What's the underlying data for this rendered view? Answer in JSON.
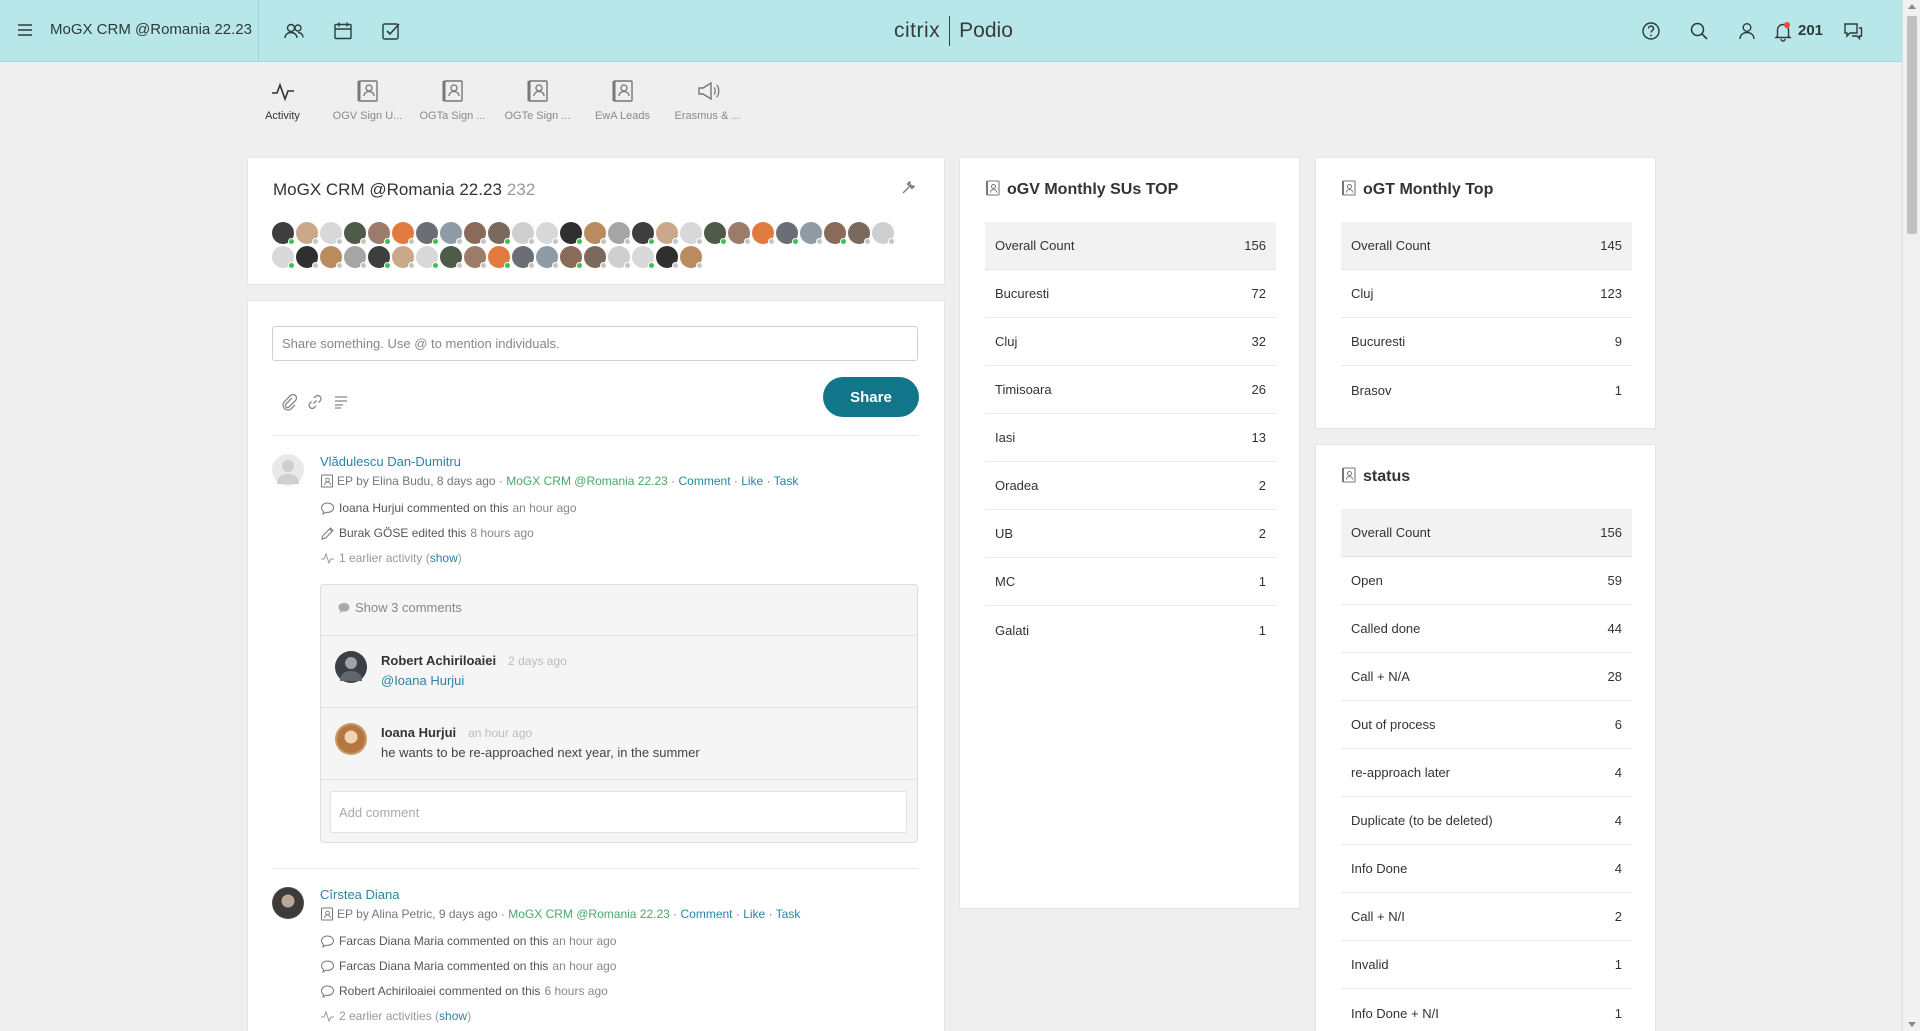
{
  "topbar": {
    "workspace_title": "MoGX CRM @Romania 22.23",
    "brand_left": "citrix",
    "brand_right": "Podio",
    "notification_count": "201"
  },
  "app_tabs": [
    {
      "label": "Activity",
      "icon": "activity-icon",
      "active": true
    },
    {
      "label": "OGV Sign U...",
      "icon": "app-icon",
      "active": false
    },
    {
      "label": "OGTa Sign ...",
      "icon": "app-icon",
      "active": false
    },
    {
      "label": "OGTe Sign ...",
      "icon": "app-icon",
      "active": false
    },
    {
      "label": "EwA Leads",
      "icon": "app-icon",
      "active": false
    },
    {
      "label": "Erasmus & ...",
      "icon": "megaphone-icon",
      "active": false
    }
  ],
  "workspace": {
    "name": "MoGX CRM @Romania 22.23",
    "member_count": "232"
  },
  "share": {
    "placeholder": "Share something. Use @ to mention individuals.",
    "button": "Share"
  },
  "posts": [
    {
      "title": "Vlădulescu Dan-Dumitru",
      "app": "EP",
      "by": "by",
      "author": "Elina Budu, 8 days ago",
      "workspace": "MoGX CRM @Romania 22.23",
      "actions": [
        "Comment",
        "Like",
        "Task"
      ],
      "activities": [
        {
          "text": "Ioana Hurjui commented on this",
          "ago": "an hour ago",
          "icon": "comment-icon"
        },
        {
          "text": "Burak GÖSE edited this",
          "ago": "8 hours ago",
          "icon": "pencil-icon"
        }
      ],
      "earlier": "1 earlier activity",
      "earlier_link": "show",
      "show_comments": "Show 3 comments",
      "comments": [
        {
          "name": "Robert Achiriloaiei",
          "time": "2 days ago",
          "text": "@Ioana Hurjui",
          "mention": true
        },
        {
          "name": "Ioana Hurjui",
          "time": "an hour ago",
          "text": "he wants to be re-approached next year, in the summer",
          "mention": false
        }
      ],
      "add_comment_placeholder": "Add comment"
    },
    {
      "title": "Cîrstea Diana",
      "app": "EP",
      "by": "by",
      "author": "Alina Petric, 9 days ago",
      "workspace": "MoGX CRM @Romania 22.23",
      "actions": [
        "Comment",
        "Like",
        "Task"
      ],
      "activities": [
        {
          "text": "Farcas Diana Maria commented on this",
          "ago": "an hour ago",
          "icon": "comment-icon"
        },
        {
          "text": "Farcas Diana Maria commented on this",
          "ago": "an hour ago",
          "icon": "comment-icon"
        },
        {
          "text": "Robert Achiriloaiei commented on this",
          "ago": "6 hours ago",
          "icon": "comment-icon"
        }
      ],
      "earlier": "2 earlier activities",
      "earlier_link": "show"
    }
  ],
  "widgets": [
    {
      "title": "oGV Monthly SUs TOP",
      "rows": [
        {
          "label": "Overall Count",
          "value": "156"
        },
        {
          "label": "Bucuresti",
          "value": "72"
        },
        {
          "label": "Cluj",
          "value": "32"
        },
        {
          "label": "Timisoara",
          "value": "26"
        },
        {
          "label": "Iasi",
          "value": "13"
        },
        {
          "label": "Oradea",
          "value": "2"
        },
        {
          "label": "UB",
          "value": "2"
        },
        {
          "label": "MC",
          "value": "1"
        },
        {
          "label": "Galati",
          "value": "1"
        }
      ]
    },
    {
      "title": "oGT Monthly Top",
      "rows": [
        {
          "label": "Overall Count",
          "value": "145"
        },
        {
          "label": "Cluj",
          "value": "123"
        },
        {
          "label": "Bucuresti",
          "value": "9"
        },
        {
          "label": "Brasov",
          "value": "1"
        }
      ]
    },
    {
      "title": "status",
      "rows": [
        {
          "label": "Overall Count",
          "value": "156"
        },
        {
          "label": "Open",
          "value": "59"
        },
        {
          "label": "Called done",
          "value": "44"
        },
        {
          "label": "Call + N/A",
          "value": "28"
        },
        {
          "label": "Out of process",
          "value": "6"
        },
        {
          "label": "re-approach later",
          "value": "4"
        },
        {
          "label": "Duplicate (to be deleted)",
          "value": "4"
        },
        {
          "label": "Info Done",
          "value": "4"
        },
        {
          "label": "Call + N/I",
          "value": "2"
        },
        {
          "label": "Invalid",
          "value": "1"
        },
        {
          "label": "Info Done + N/I",
          "value": "1"
        }
      ]
    }
  ],
  "colors": {
    "topbar": "#b8e7e9",
    "accent": "#11768a",
    "link": "#2a84a5",
    "workspace_link": "#4aa866"
  }
}
